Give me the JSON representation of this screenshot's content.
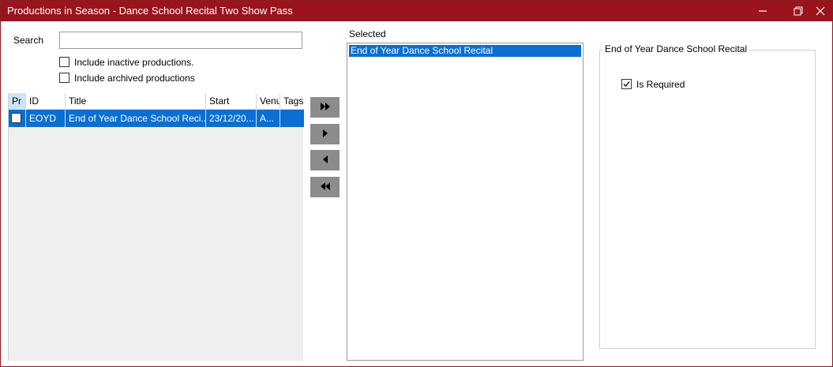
{
  "window": {
    "title": "Productions in Season - Dance School Recital Two Show Pass",
    "accent_color": "#9b141d",
    "controls": [
      "minimize-icon",
      "maximize-icon",
      "close-icon"
    ]
  },
  "search": {
    "label": "Search",
    "value": "",
    "placeholder": ""
  },
  "filters": {
    "include_inactive": {
      "label": "Include inactive productions.",
      "checked": false
    },
    "include_archived": {
      "label": "Include archived productions",
      "checked": false
    }
  },
  "productions_grid": {
    "columns": [
      "Pr",
      "ID",
      "Title",
      "Start",
      "Venu",
      "Tags"
    ],
    "rows": [
      {
        "selected": true,
        "checked": false,
        "id": "EOYD",
        "title": "End of Year Dance School Reci...",
        "start": "23/12/20...",
        "venue": "A...",
        "tags": ""
      }
    ]
  },
  "move_buttons": {
    "add_all": "fast-forward-icon",
    "add": "play-right-icon",
    "remove": "play-left-icon",
    "remove_all": "fast-rewind-icon"
  },
  "selected": {
    "label": "Selected",
    "items": [
      "End of Year Dance School Recital"
    ]
  },
  "details": {
    "group_title": "End of Year Dance School Recital",
    "is_required": {
      "label": "Is Required",
      "checked": true
    }
  },
  "colors": {
    "selection": "#0a6fd1",
    "button_gray": "#8c8c8c"
  }
}
